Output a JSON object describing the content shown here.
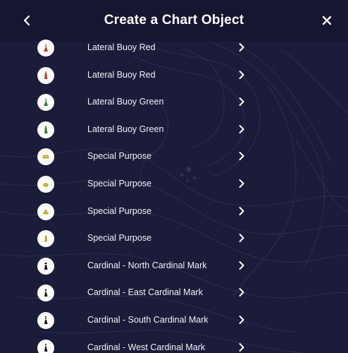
{
  "header": {
    "title": "Create a Chart Object",
    "back_icon": "chevron-left-icon",
    "close_icon": "close-icon"
  },
  "colors": {
    "background": "#1a1c3a",
    "header_bg": "#151630",
    "text": "#ffffff",
    "icon_red": "#c0392b",
    "icon_green": "#2e7d32",
    "icon_yellow": "#e5c200",
    "icon_black": "#111111"
  },
  "items": [
    {
      "label": "Lateral Buoy Red",
      "icon": "lateral-buoy-red-icon",
      "color": "#c0392b"
    },
    {
      "label": "Lateral Buoy Red",
      "icon": "lateral-buoy-red-icon",
      "color": "#c0392b"
    },
    {
      "label": "Lateral Buoy Green",
      "icon": "lateral-buoy-green-icon",
      "color": "#2e7d32"
    },
    {
      "label": "Lateral Buoy Green",
      "icon": "lateral-buoy-green-icon",
      "color": "#2e7d32"
    },
    {
      "label": "Special Purpose",
      "icon": "special-purpose-icon",
      "color": "#e5c200"
    },
    {
      "label": "Special Purpose",
      "icon": "special-purpose-icon",
      "color": "#e5c200"
    },
    {
      "label": "Special Purpose",
      "icon": "special-purpose-icon",
      "color": "#e5c200"
    },
    {
      "label": "Special Purpose",
      "icon": "special-purpose-icon",
      "color": "#e5c200"
    },
    {
      "label": "Cardinal - North Cardinal Mark",
      "icon": "cardinal-north-icon",
      "color": "#111111"
    },
    {
      "label": "Cardinal - East Cardinal Mark",
      "icon": "cardinal-east-icon",
      "color": "#111111"
    },
    {
      "label": "Cardinal - South Cardinal Mark",
      "icon": "cardinal-south-icon",
      "color": "#111111"
    },
    {
      "label": "Cardinal - West Cardinal Mark",
      "icon": "cardinal-west-icon",
      "color": "#111111"
    }
  ]
}
